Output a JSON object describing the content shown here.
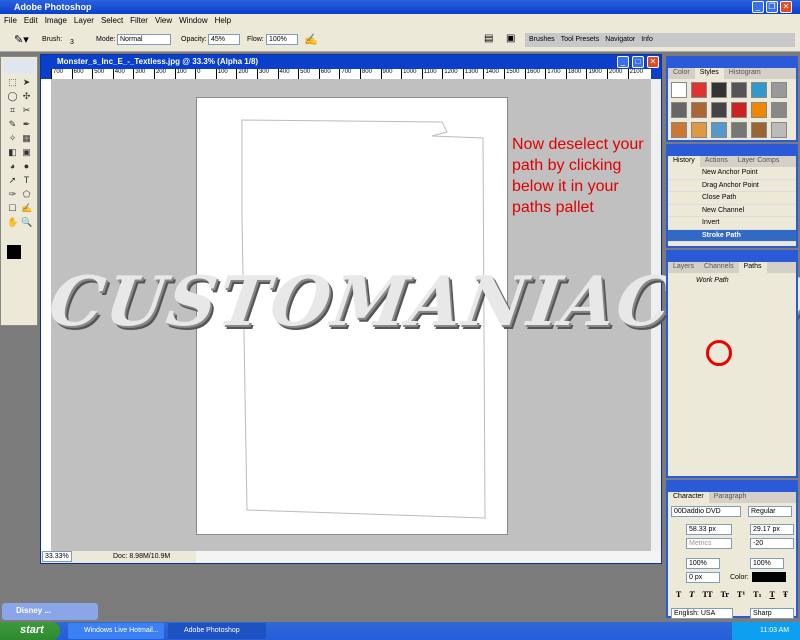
{
  "app": {
    "title": "Adobe Photoshop"
  },
  "menu": [
    "File",
    "Edit",
    "Image",
    "Layer",
    "Select",
    "Filter",
    "View",
    "Window",
    "Help"
  ],
  "options": {
    "brush_label": "Brush:",
    "brush_size": "3",
    "mode_label": "Mode:",
    "mode_value": "Normal",
    "opacity_label": "Opacity:",
    "opacity_value": "45%",
    "flow_label": "Flow:",
    "flow_value": "100%"
  },
  "well_tabs": [
    "Brushes",
    "Tool Presets",
    "Navigator",
    "Info"
  ],
  "document": {
    "title": "Monster_s_Inc_E_-_Textless.jpg @ 33.3% (Alpha 1/8)",
    "ruler_ticks": [
      "700",
      "600",
      "500",
      "400",
      "300",
      "200",
      "100",
      "0",
      "100",
      "200",
      "300",
      "400",
      "500",
      "600",
      "700",
      "800",
      "900",
      "1000",
      "1100",
      "1200",
      "1300",
      "1400",
      "1500",
      "1600",
      "1700",
      "1800",
      "1900",
      "2000",
      "2100"
    ],
    "zoom": "33.33%",
    "doc_size": "Doc: 8.98M/10.9M"
  },
  "annotation": "Now deselect your path by clicking below it in your paths pallet",
  "watermark": "CUSTOMANIACS.ORG",
  "styles_panel": {
    "tabs": [
      "Color",
      "Styles",
      "Histogram"
    ]
  },
  "history_panel": {
    "tabs": [
      "History",
      "Actions",
      "Layer Comps"
    ],
    "items": [
      "New Anchor Point",
      "Drag Anchor Point",
      "Close Path",
      "New Channel",
      "Invert",
      "Stroke Path"
    ],
    "selected": "Stroke Path"
  },
  "paths_panel": {
    "tabs": [
      "Layers",
      "Channels",
      "Paths"
    ],
    "items": [
      "Work Path"
    ]
  },
  "character_panel": {
    "tabs": [
      "Character",
      "Paragraph"
    ],
    "font": "00Daddio DVD",
    "style": "Regular",
    "size": "58.33 px",
    "leading": "29.17 px",
    "kerning": "Metrics",
    "tracking": "-20",
    "vscale": "100%",
    "hscale": "100%",
    "baseline": "0 px",
    "color_label": "Color:",
    "color": "#000000",
    "language": "English: USA",
    "antialias": "Sharp",
    "type_buttons": [
      "T",
      "T",
      "TT",
      "Tr",
      "T¹",
      "T₁",
      "T",
      "Ŧ"
    ]
  },
  "minimized": {
    "title": "Disney ..."
  },
  "taskbar": {
    "start": "start",
    "buttons": [
      "Windows Live Hotmail...",
      "Adobe Photoshop"
    ],
    "clock": "11:03 AM"
  }
}
